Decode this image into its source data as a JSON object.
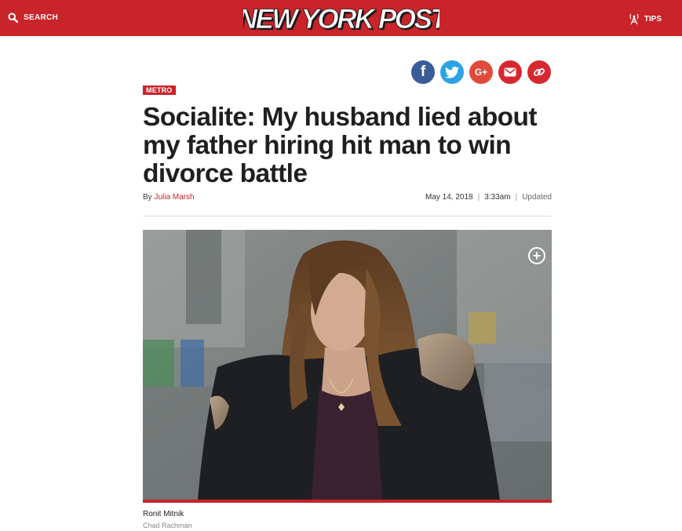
{
  "header": {
    "search_label": "SEARCH",
    "logo_text": "NEW YORK POST",
    "tips_label": "TIPS",
    "bar_color": "#c8242a"
  },
  "share": [
    {
      "name": "facebook",
      "icon": "facebook-icon",
      "glyph": "f",
      "color": "#3a5a98"
    },
    {
      "name": "twitter",
      "icon": "twitter-icon",
      "color": "#2ba3e5"
    },
    {
      "name": "google-plus",
      "icon": "google-plus-icon",
      "glyph": "G+",
      "color": "#e04b3b"
    },
    {
      "name": "email",
      "icon": "email-icon",
      "color": "#d7282f"
    },
    {
      "name": "link",
      "icon": "link-icon",
      "color": "#d7282f"
    }
  ],
  "article": {
    "section": "METRO",
    "headline": "Socialite: My husband lied about my father hiring hit man to win divorce battle",
    "by_prefix": "By",
    "author": "Julia Marsh",
    "date": "May 14, 2018",
    "separator": "|",
    "time": "3:33am",
    "updated": "Updated"
  },
  "photo": {
    "expand_glyph": "+",
    "caption": "Ronit Mitnik",
    "credit": "Chad Rachman"
  }
}
